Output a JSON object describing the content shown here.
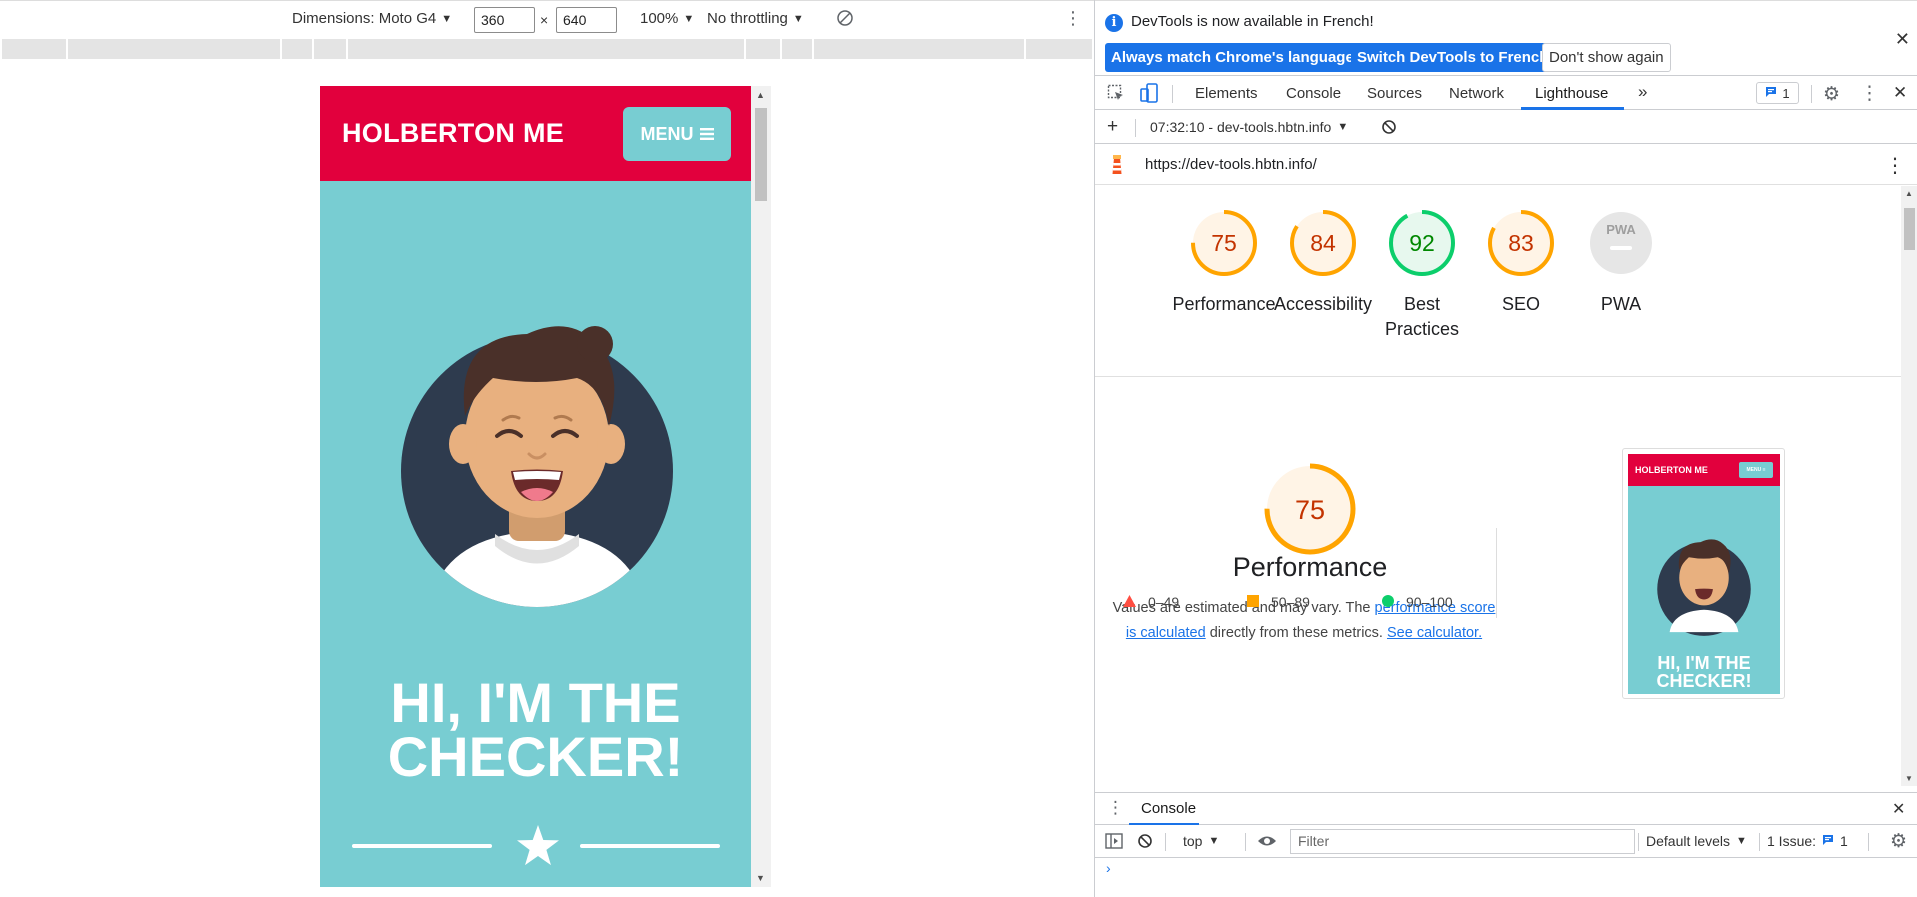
{
  "device_toolbar": {
    "dimensions_label": "Dimensions: Moto G4",
    "width": "360",
    "height": "640",
    "times": "×",
    "zoom": "100%",
    "throttling": "No throttling"
  },
  "mobile_page": {
    "brand": "HOLBERTON ME",
    "menu_label": "MENU",
    "hero_line1": "HI, I'M THE",
    "hero_line2": "CHECKER!"
  },
  "infobar": {
    "message": "DevTools is now available in French!",
    "btn_match": "Always match Chrome's language",
    "btn_switch": "Switch DevTools to French",
    "btn_dismiss": "Don't show again"
  },
  "tabs": {
    "elements": "Elements",
    "console": "Console",
    "sources": "Sources",
    "network": "Network",
    "lighthouse": "Lighthouse",
    "more": "»",
    "issues_count": "1"
  },
  "lighthouse_bar": {
    "report": "07:32:10 - dev-tools.hbtn.info",
    "url": "https://dev-tools.hbtn.info/"
  },
  "scores": [
    {
      "label": "Performance",
      "value": "75",
      "status": "average"
    },
    {
      "label": "Accessibility",
      "value": "84",
      "status": "average"
    },
    {
      "label": "Best Practices",
      "value": "92",
      "status": "pass"
    },
    {
      "label": "SEO",
      "value": "83",
      "status": "average"
    },
    {
      "label": "PWA",
      "value": "PWA",
      "status": "na"
    }
  ],
  "performance": {
    "score": "75",
    "title": "Performance",
    "desc_prefix": "Values are estimated and may vary. The ",
    "desc_link1": "performance score is calculated",
    "desc_middle": " directly from these metrics. ",
    "desc_link2": "See calculator.",
    "legend_fail": "0–49",
    "legend_average": "50–89",
    "legend_pass": "90–100"
  },
  "thumbnail": {
    "brand": "HOLBERTON ME",
    "menu": "MENU ≡",
    "hero_line1": "HI, I'M THE",
    "hero_line2": "CHECKER!"
  },
  "drawer": {
    "tab": "Console",
    "context": "top",
    "filter_placeholder": "Filter",
    "levels": "Default levels",
    "issues_label": "1 Issue:",
    "issues_count": "1",
    "prompt": "›"
  },
  "colors": {
    "average": "#ffa400",
    "average_text": "#c33300",
    "pass": "#0cce6b",
    "pass_text": "#008800",
    "fail": "#ff4e42",
    "brand_red": "#e2003d",
    "teal": "#78cdd2",
    "devtools_blue": "#1a73e8"
  }
}
